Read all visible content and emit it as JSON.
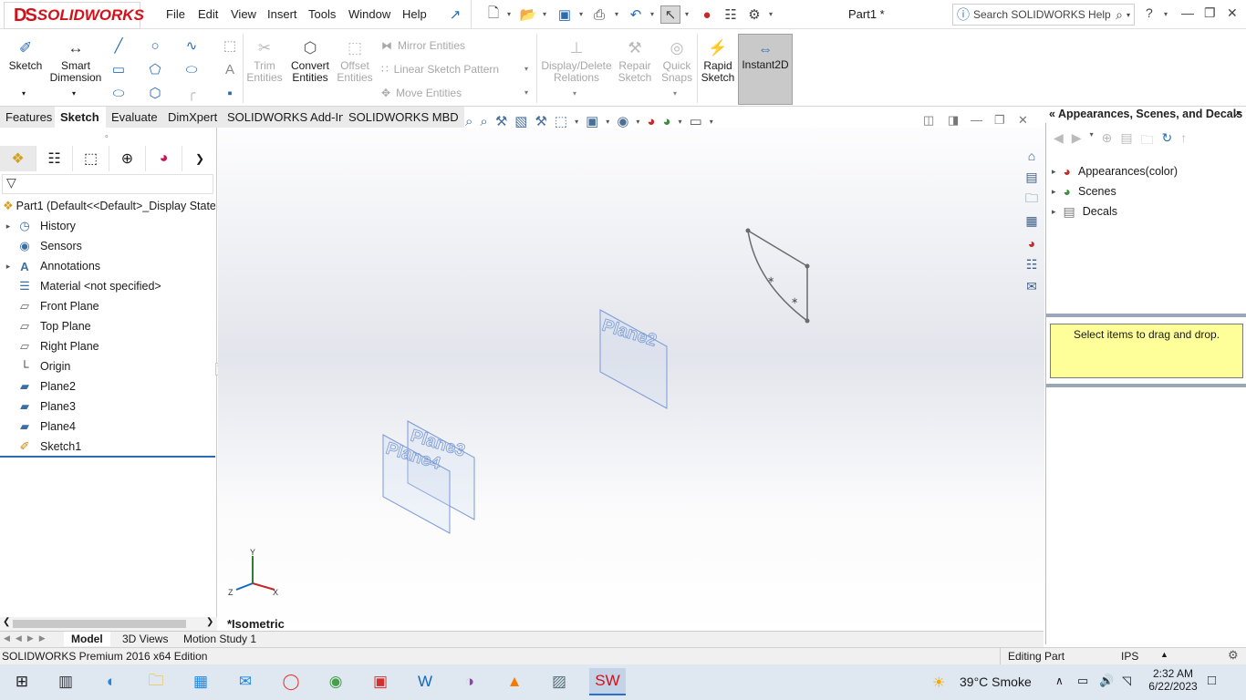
{
  "app": {
    "logo": "SOLIDWORKS",
    "document_title": "Part1 *",
    "menu": [
      "File",
      "Edit",
      "View",
      "Insert",
      "Tools",
      "Window",
      "Help"
    ],
    "search_placeholder": "Search SOLIDWORKS Help"
  },
  "command_manager": {
    "sketch": "Sketch",
    "smart_dimension": "Smart Dimension",
    "trim_entities": "Trim Entities",
    "convert_entities": "Convert Entities",
    "offset_entities": "Offset Entities",
    "mirror_entities": "Mirror Entities",
    "linear_sketch_pattern": "Linear Sketch Pattern",
    "move_entities": "Move Entities",
    "display_delete_relations": "Display/Delete Relations",
    "repair_sketch": "Repair Sketch",
    "quick_snaps": "Quick Snaps",
    "rapid_sketch": "Rapid Sketch",
    "instant2d": "Instant2D"
  },
  "tabs": [
    "Features",
    "Sketch",
    "Evaluate",
    "DimXpert",
    "SOLIDWORKS Add-Ins",
    "SOLIDWORKS MBD"
  ],
  "active_tab": "Sketch",
  "feature_tree": {
    "root": "Part1  (Default<<Default>_Display State",
    "items": [
      "History",
      "Sensors",
      "Annotations",
      "Material <not specified>",
      "Front Plane",
      "Top Plane",
      "Right Plane",
      "Origin",
      "Plane2",
      "Plane3",
      "Plane4",
      "Sketch1"
    ]
  },
  "viewport": {
    "view_label": "*Isometric",
    "plane_labels": [
      "Plane2",
      "Plane3",
      "Plane4"
    ],
    "triad": [
      "Y",
      "X",
      "Z"
    ]
  },
  "task_pane": {
    "title": "Appearances, Scenes, and Decals",
    "items": [
      "Appearances(color)",
      "Scenes",
      "Decals"
    ],
    "drag_hint": "Select items to drag and drop."
  },
  "bottom_tabs": [
    "Model",
    "3D Views",
    "Motion Study 1"
  ],
  "status_bar": {
    "left": "SOLIDWORKS Premium 2016 x64 Edition",
    "mode": "Editing Part",
    "units": "IPS"
  },
  "taskbar": {
    "weather": "39°C  Smoke",
    "time": "2:32 AM",
    "date": "6/22/2023"
  }
}
